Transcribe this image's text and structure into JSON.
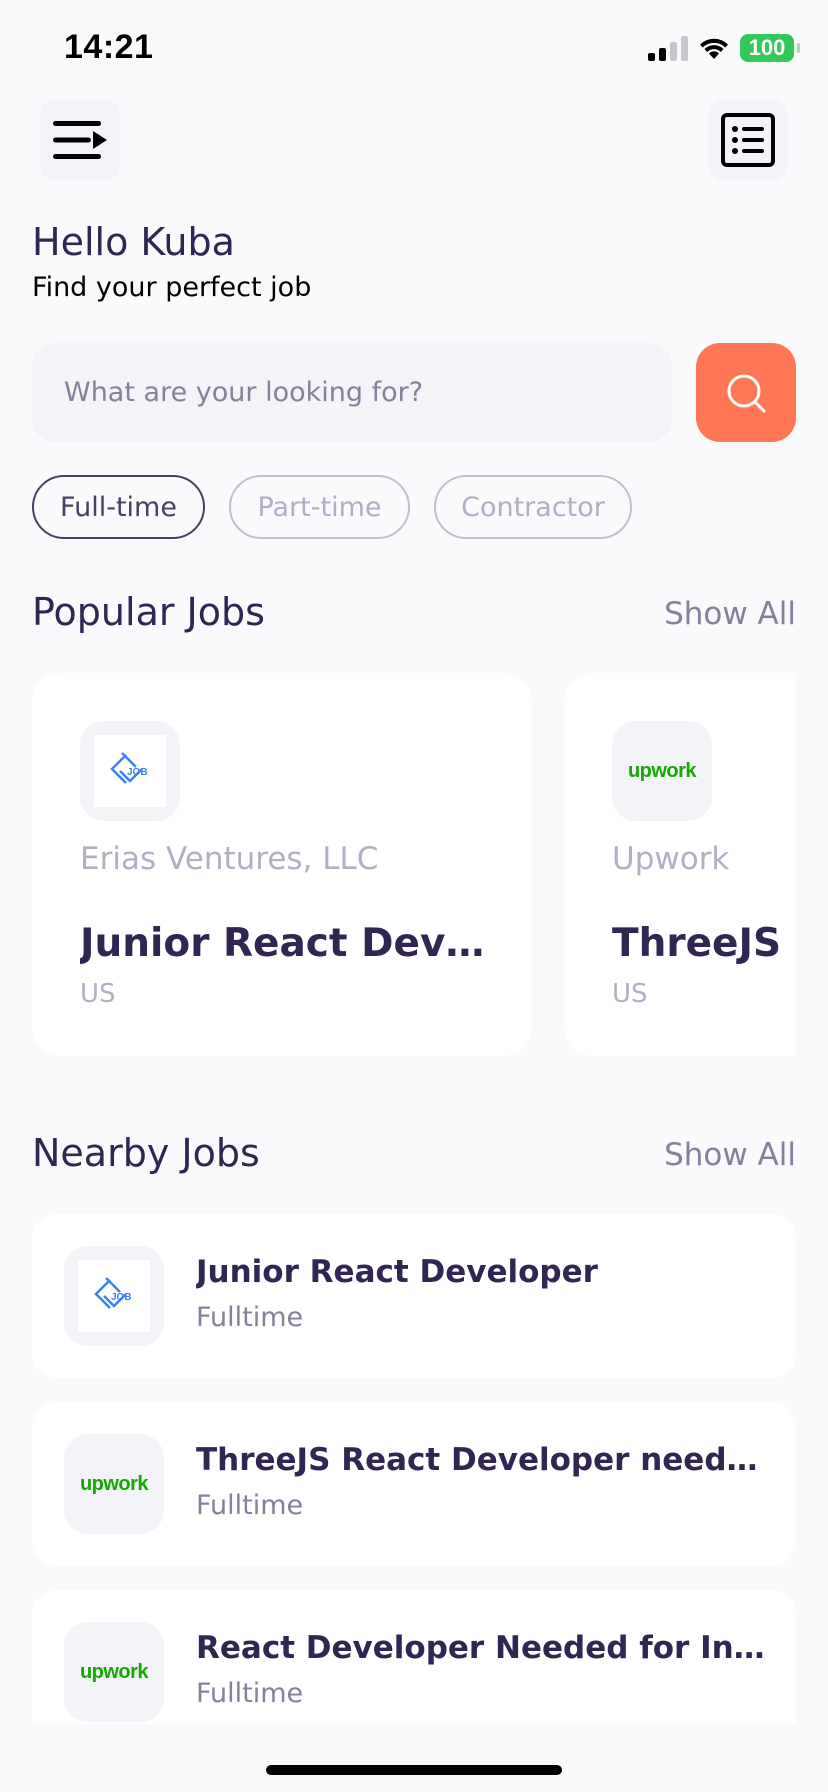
{
  "status": {
    "time": "14:21",
    "battery": "100"
  },
  "icons": {
    "menu": "menu-icon",
    "list": "list-icon",
    "search": "search-icon"
  },
  "colors": {
    "accent": "#ff7754",
    "primary": "#312651",
    "gray": "#83829a",
    "upwork_green": "#14a800",
    "job_blue": "#3b82f6"
  },
  "greeting": {
    "hello": "Hello Kuba",
    "subtitle": "Find your perfect job"
  },
  "search": {
    "placeholder": "What are your looking for?",
    "value": ""
  },
  "tabs": [
    {
      "label": "Full-time",
      "active": true
    },
    {
      "label": "Part-time",
      "active": false
    },
    {
      "label": "Contractor",
      "active": false
    }
  ],
  "popular": {
    "title": "Popular Jobs",
    "show_all": "Show All",
    "items": [
      {
        "logo": "JOB",
        "company": "Erias Ventures, LLC",
        "title": "Junior React Developer",
        "location": "US"
      },
      {
        "logo": "upwork",
        "company": "Upwork",
        "title": "ThreeJS React Developer needed",
        "location": "US"
      }
    ]
  },
  "nearby": {
    "title": "Nearby Jobs",
    "show_all": "Show All",
    "items": [
      {
        "logo": "JOB",
        "title": "Junior React Developer",
        "type": "Fulltime"
      },
      {
        "logo": "upwork",
        "title": "ThreeJS React Developer needed for a project",
        "type": "Fulltime"
      },
      {
        "logo": "upwork",
        "title": "React Developer Needed for Innovative Project",
        "type": "Fulltime"
      }
    ]
  }
}
